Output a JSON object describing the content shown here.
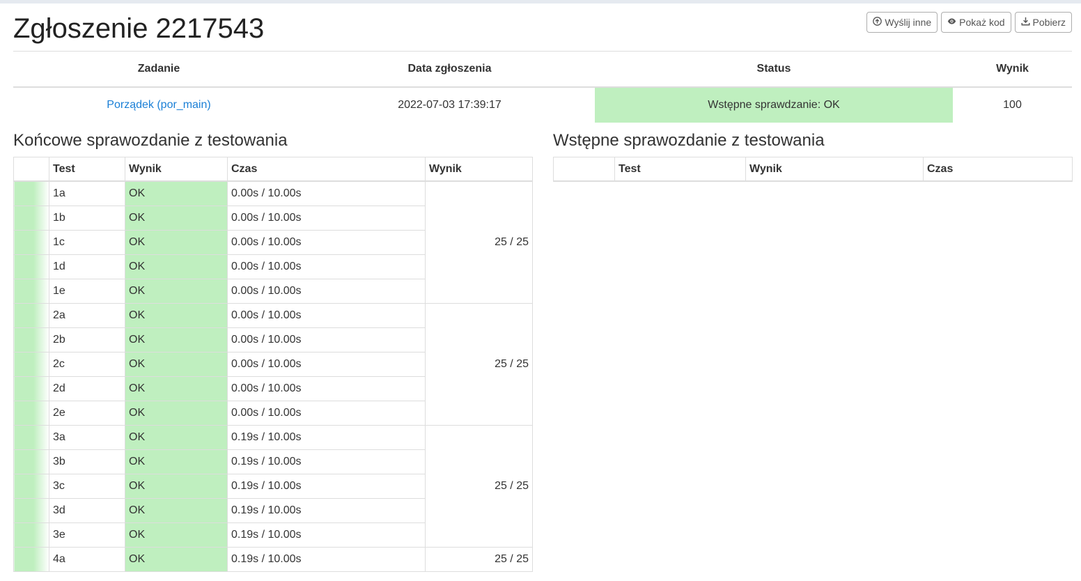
{
  "header": {
    "title": "Zgłoszenie 2217543",
    "buttons": {
      "resubmit": "Wyślij inne",
      "show_code": "Pokaż kod",
      "download": "Pobierz"
    }
  },
  "submission": {
    "headers": [
      "Zadanie",
      "Data zgłoszenia",
      "Status",
      "Wynik"
    ],
    "task": "Porządek (por_main)",
    "date": "2022-07-03 17:39:17",
    "status": "Wstępne sprawdzanie: OK",
    "score": "100",
    "status_color": "#bfefbf",
    "link_color": "#1a7fd6"
  },
  "final_report": {
    "title": "Końcowe sprawozdanie z testowania",
    "headers": [
      "",
      "Test",
      "Wynik",
      "Czas",
      "Wynik"
    ],
    "rows": [
      {
        "test": "1a",
        "result": "OK",
        "time": "0.00s / 10.00s"
      },
      {
        "test": "1b",
        "result": "OK",
        "time": "0.00s / 10.00s"
      },
      {
        "test": "1c",
        "result": "OK",
        "time": "0.00s / 10.00s"
      },
      {
        "test": "1d",
        "result": "OK",
        "time": "0.00s / 10.00s"
      },
      {
        "test": "1e",
        "result": "OK",
        "time": "0.00s / 10.00s"
      },
      {
        "test": "2a",
        "result": "OK",
        "time": "0.00s / 10.00s"
      },
      {
        "test": "2b",
        "result": "OK",
        "time": "0.00s / 10.00s"
      },
      {
        "test": "2c",
        "result": "OK",
        "time": "0.00s / 10.00s"
      },
      {
        "test": "2d",
        "result": "OK",
        "time": "0.00s / 10.00s"
      },
      {
        "test": "2e",
        "result": "OK",
        "time": "0.00s / 10.00s"
      },
      {
        "test": "3a",
        "result": "OK",
        "time": "0.19s / 10.00s"
      },
      {
        "test": "3b",
        "result": "OK",
        "time": "0.19s / 10.00s"
      },
      {
        "test": "3c",
        "result": "OK",
        "time": "0.19s / 10.00s"
      },
      {
        "test": "3d",
        "result": "OK",
        "time": "0.19s / 10.00s"
      },
      {
        "test": "3e",
        "result": "OK",
        "time": "0.19s / 10.00s"
      },
      {
        "test": "4a",
        "result": "OK",
        "time": "0.19s / 10.00s"
      }
    ],
    "groups": [
      {
        "start": 0,
        "span": 5,
        "score": "25 / 25"
      },
      {
        "start": 5,
        "span": 5,
        "score": "25 / 25"
      },
      {
        "start": 10,
        "span": 5,
        "score": "25 / 25"
      },
      {
        "start": 15,
        "span": 1,
        "score": "25 / 25"
      }
    ]
  },
  "initial_report": {
    "title": "Wstępne sprawozdanie z testowania",
    "headers": [
      "",
      "Test",
      "Wynik",
      "Czas"
    ]
  }
}
